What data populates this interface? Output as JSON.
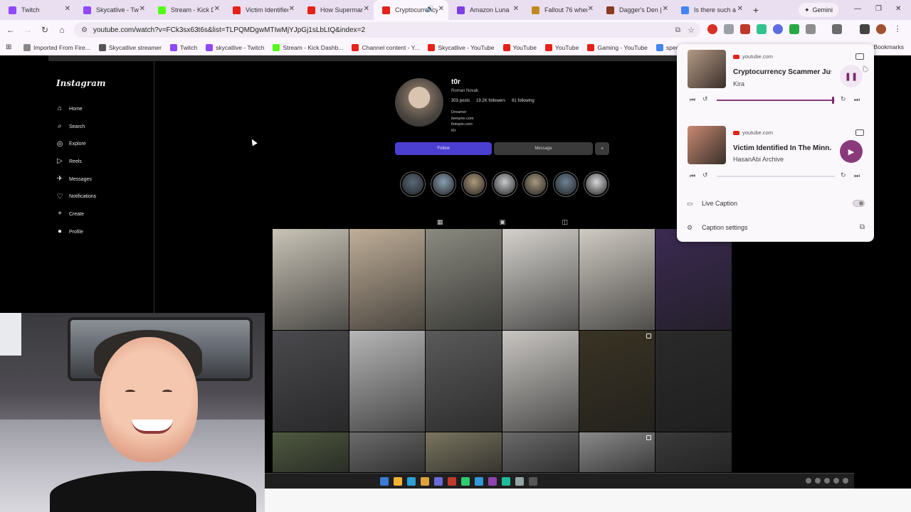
{
  "browser": {
    "tabs": [
      {
        "title": "Twitch",
        "icon": "twitch-icon",
        "color": "#9146ff",
        "active": false
      },
      {
        "title": "Skycatlive - Twitch",
        "icon": "twitch-icon",
        "color": "#9146ff",
        "active": false
      },
      {
        "title": "Stream - Kick Dashboard",
        "icon": "kick-icon",
        "color": "#53fc18",
        "active": false
      },
      {
        "title": "Victim Identified In The Minn",
        "icon": "youtube-icon",
        "color": "#e62117",
        "active": false
      },
      {
        "title": "How Superman",
        "icon": "youtube-icon",
        "color": "#e62117",
        "active": false
      },
      {
        "title": "Cryptocurrency",
        "icon": "youtube-icon",
        "color": "#e62117",
        "active": true
      },
      {
        "title": "Amazon Luna",
        "icon": "luna-icon",
        "color": "#7b3fe4",
        "active": false
      },
      {
        "title": "Fallout 76 when",
        "icon": "game-icon",
        "color": "#c08a1e",
        "active": false
      },
      {
        "title": "Dagger's Den |",
        "icon": "dagger-icon",
        "color": "#8b3a1c",
        "active": false
      },
      {
        "title": "Is there such a",
        "icon": "google-icon",
        "color": "#4285f4",
        "active": false
      }
    ],
    "gemini_label": "Gemini",
    "url": "youtube.com/watch?v=FCk3sx63t6s&list=TLPQMDgwMTIwMjYJpGj1sLbLtQ&index=2",
    "bookmarks": [
      {
        "label": "Imported From Fire...",
        "icon": "folder-icon",
        "color": "#888888"
      },
      {
        "label": "Skycatlive streamer",
        "icon": "stream-icon",
        "color": "#555555"
      },
      {
        "label": "Twitch",
        "icon": "twitch-icon",
        "color": "#9146ff"
      },
      {
        "label": "skycatlive - Twitch",
        "icon": "twitch-icon",
        "color": "#9146ff"
      },
      {
        "label": "Stream - Kick Dashb...",
        "icon": "kick-icon",
        "color": "#53fc18"
      },
      {
        "label": "Channel content - Y...",
        "icon": "youtube-icon",
        "color": "#e62117"
      },
      {
        "label": "Skycatlive - YouTube",
        "icon": "youtube-icon",
        "color": "#e62117"
      },
      {
        "label": "YouTube",
        "icon": "youtube-icon",
        "color": "#e62117"
      },
      {
        "label": "YouTube",
        "icon": "youtube-icon",
        "color": "#e62117"
      },
      {
        "label": "Gaming - YouTube",
        "icon": "youtube-icon",
        "color": "#e62117"
      },
      {
        "label": "speedtest - Goo",
        "icon": "google-icon",
        "color": "#4285f4"
      }
    ],
    "all_bookmarks_label": "Bookmarks"
  },
  "instagram": {
    "logo": "Instagram",
    "nav": [
      {
        "label": "Home",
        "icon": "home-icon"
      },
      {
        "label": "Search",
        "icon": "search-icon"
      },
      {
        "label": "Explore",
        "icon": "explore-icon"
      },
      {
        "label": "Reels",
        "icon": "reels-icon"
      },
      {
        "label": "Messages",
        "icon": "messages-icon"
      },
      {
        "label": "Notifications",
        "icon": "heart-icon"
      },
      {
        "label": "Create",
        "icon": "plus-icon"
      },
      {
        "label": "Profile",
        "icon": "profile-icon"
      }
    ],
    "profile": {
      "username": "t0r",
      "full_name": "Roman Novak",
      "posts": "303 posts",
      "followers": "19.2K followers",
      "following": "61 following",
      "bio": [
        "Dreamer",
        "itempire.com",
        "fintopio.com",
        "t0r"
      ],
      "follow_label": "Follow",
      "message_label": "Message",
      "more_label": "+"
    },
    "highlight_colors": [
      "#5a6a7a",
      "#8aa0b4",
      "#b09a7a",
      "#c7c9cc",
      "#a8987e",
      "#6e8294",
      "#d8d8da"
    ],
    "grid_colors": [
      "#c9c3b6",
      "#bfae98",
      "#8b8a80",
      "#d4d1cc",
      "#cfcac2",
      "#3b2a52",
      "#4a4a4e",
      "#b6b6b6",
      "#5a5a5a",
      "#c9c6c2",
      "#3a3324",
      "#2a2a2a",
      "#4f5a40",
      "#6b6b6b",
      "#7a7560",
      "#6a6a6a",
      "#8a8a8a",
      "#3a3a3a"
    ]
  },
  "media_popup": {
    "items": [
      {
        "source": "youtube.com",
        "title": "Cryptocurrency Scammer Jus...",
        "artist": "Kira",
        "state_icon": "pause-icon",
        "progress": 0.98,
        "btn_bg": "#f1e6f3",
        "btn_fg": "#7a2a6a",
        "thumb": "#b49a86"
      },
      {
        "source": "youtube.com",
        "title": "Victim Identified In The Minn...",
        "artist": "HasanAbi Archive",
        "state_icon": "play-icon",
        "progress": 0.0,
        "btn_bg": "#8a3a7a",
        "btn_fg": "#ffffff",
        "thumb": "#c98a72"
      }
    ],
    "live_caption_label": "Live Caption",
    "caption_settings_label": "Caption settings"
  },
  "taskbar_colors": [
    "#3a7bd5",
    "#f2b233",
    "#2a9fd8",
    "#e0a13a",
    "#6b6bd8",
    "#c0392b",
    "#2ecc71",
    "#3498db",
    "#8e44ad",
    "#1abc9c",
    "#95a5a6",
    "#555555"
  ]
}
